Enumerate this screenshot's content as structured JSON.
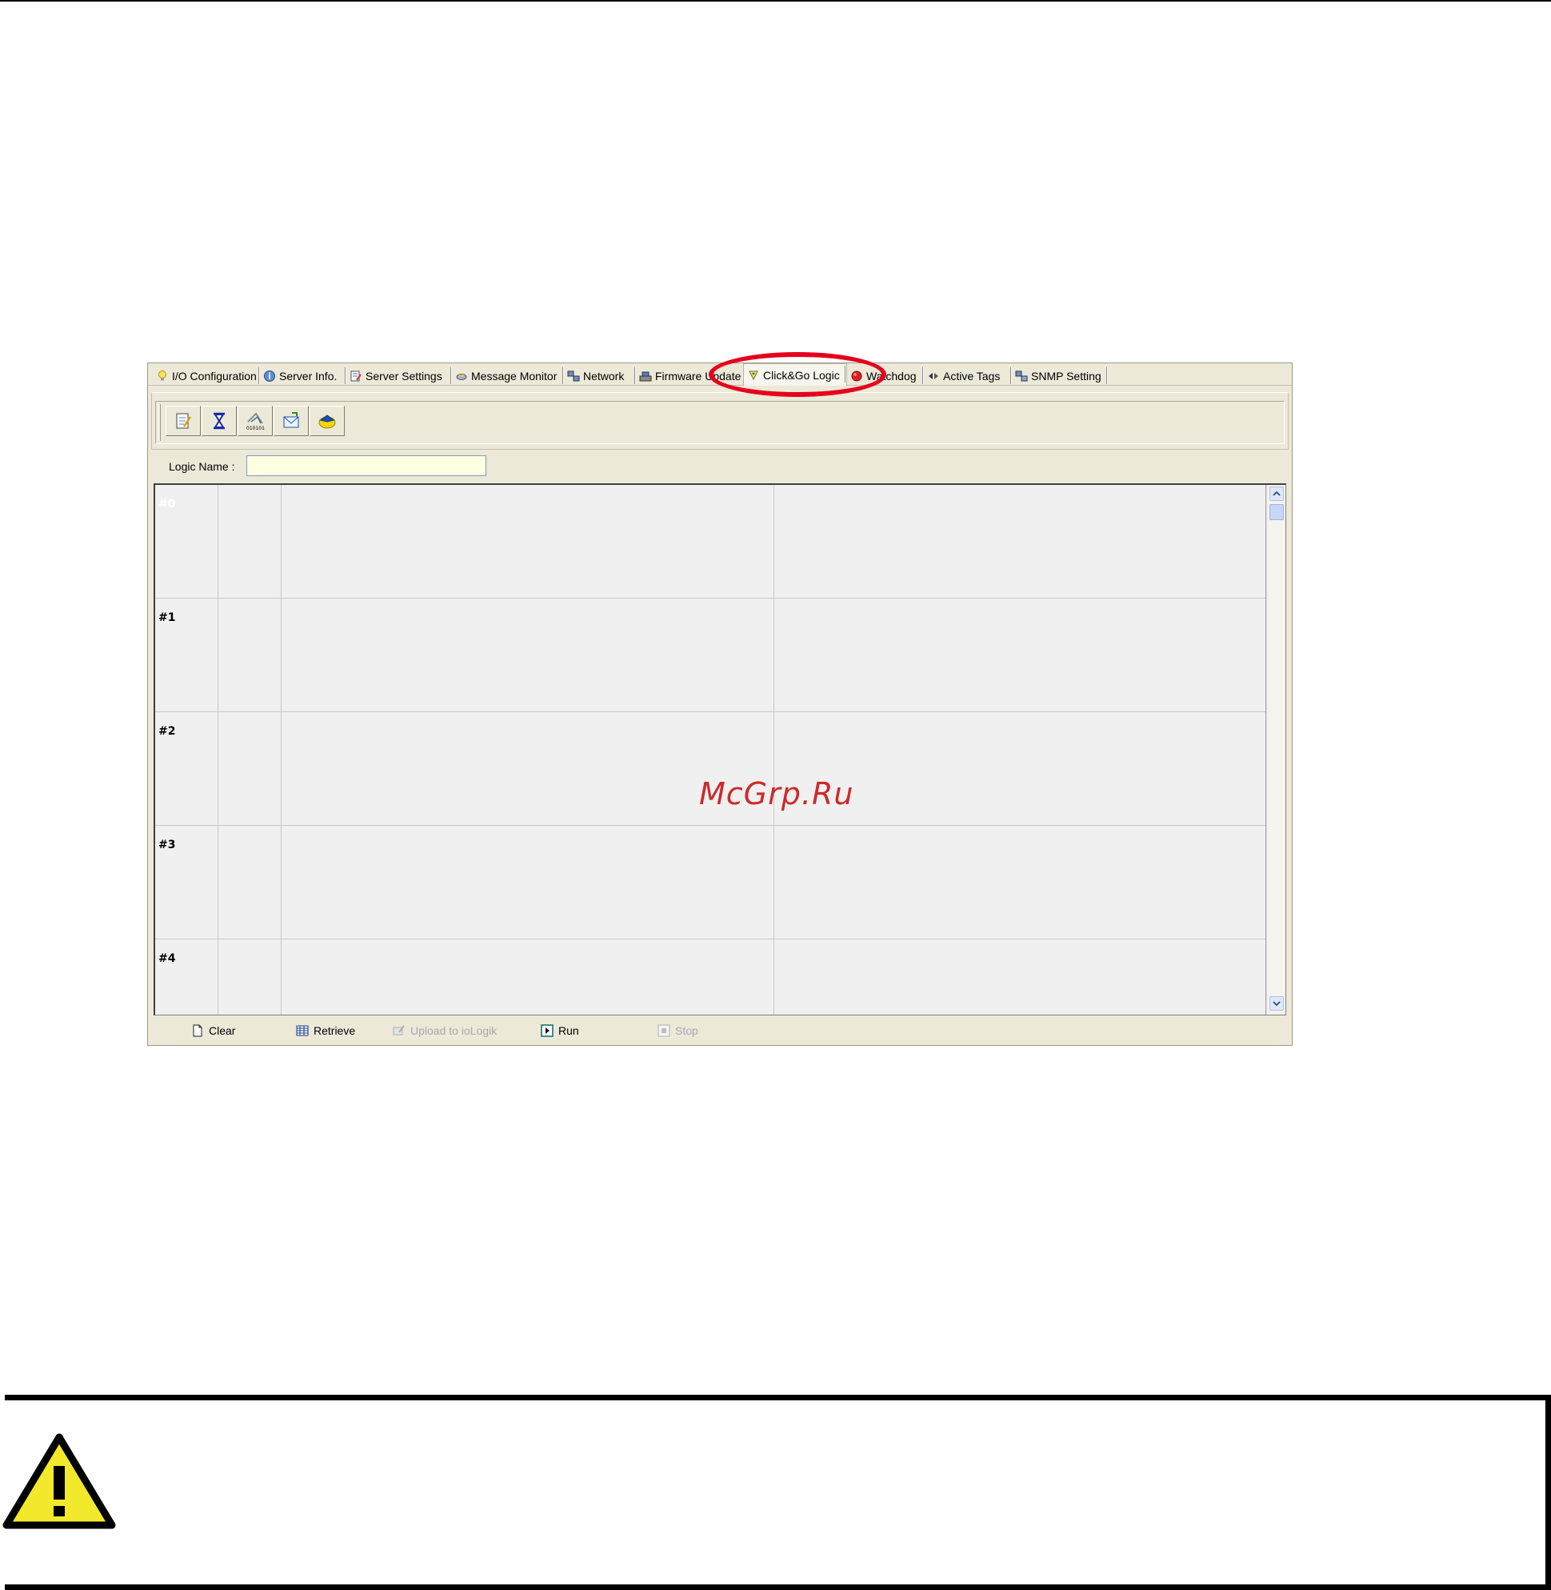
{
  "tabs": [
    {
      "label": "I/O Configuration",
      "icon": "lightbulb-icon"
    },
    {
      "label": "Server Info.",
      "icon": "globe-info-icon"
    },
    {
      "label": "Server Settings",
      "icon": "settings-document-icon"
    },
    {
      "label": "Message Monitor",
      "icon": "message-icon"
    },
    {
      "label": "Network",
      "icon": "network-icon"
    },
    {
      "label": "Firmware Update",
      "icon": "firmware-icon"
    },
    {
      "label": "Click&Go Logic",
      "icon": "logic-icon"
    },
    {
      "label": "Watchdog",
      "icon": "watchdog-icon"
    },
    {
      "label": "Active Tags",
      "icon": "active-tags-icon"
    },
    {
      "label": "SNMP Setting",
      "icon": "snmp-icon"
    }
  ],
  "active_tab": "Click&Go Logic",
  "toolbar": {
    "buttons": [
      {
        "icon": "edit-notepad-icon"
      },
      {
        "icon": "hourglass-timer-icon"
      },
      {
        "icon": "binary-signal-icon",
        "caption": "010101"
      },
      {
        "icon": "email-icon"
      },
      {
        "icon": "snmp-trap-icon"
      }
    ]
  },
  "logic": {
    "label": "Logic Name :",
    "value": ""
  },
  "rules": [
    {
      "label": "#0"
    },
    {
      "label": "#1"
    },
    {
      "label": "#2"
    },
    {
      "label": "#3"
    },
    {
      "label": "#4"
    }
  ],
  "bottom": {
    "clear": "Clear",
    "retrieve": "Retrieve",
    "upload": "Upload to ioLogik",
    "run": "Run",
    "stop": "Stop"
  },
  "watermark": "McGrp.Ru",
  "colors": {
    "window_bg": "#ece9d8",
    "grid_bg": "#f0f0f0",
    "logic_input_bg": "#ffffe1",
    "highlight": "#e5001c",
    "warning_yellow": "#f2e82c"
  }
}
